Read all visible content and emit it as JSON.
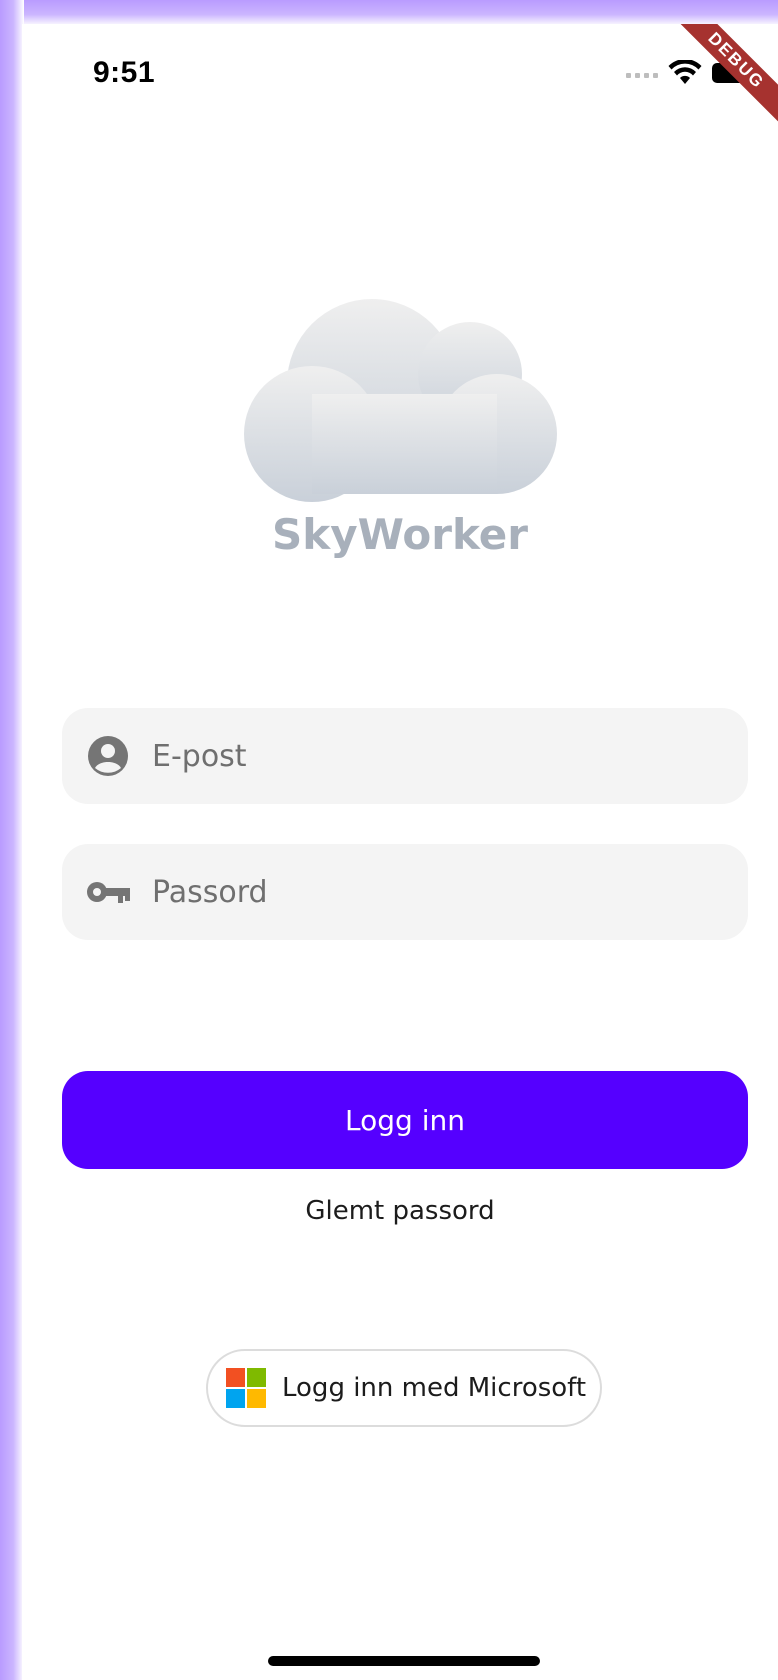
{
  "status_bar": {
    "time": "9:51",
    "debug_label": "DEBUG"
  },
  "brand": {
    "app_name": "SkyWorker",
    "logo_icon": "cloud-logo"
  },
  "form": {
    "email_placeholder": "E-post",
    "email_icon": "account-circle-icon",
    "password_placeholder": "Passord",
    "password_icon": "key-icon",
    "login_label": "Logg inn",
    "forgot_label": "Glemt passord",
    "microsoft_label": "Logg inn med Microsoft",
    "microsoft_icon": "microsoft-logo-icon"
  },
  "colors": {
    "accent": "#5500ff",
    "field_bg": "#f4f4f4",
    "brand_text": "#a8b0bb",
    "debug_ribbon": "#a6322f",
    "ms_red": "#f25022",
    "ms_green": "#7fba00",
    "ms_blue": "#00a4ef",
    "ms_yellow": "#ffb900"
  }
}
